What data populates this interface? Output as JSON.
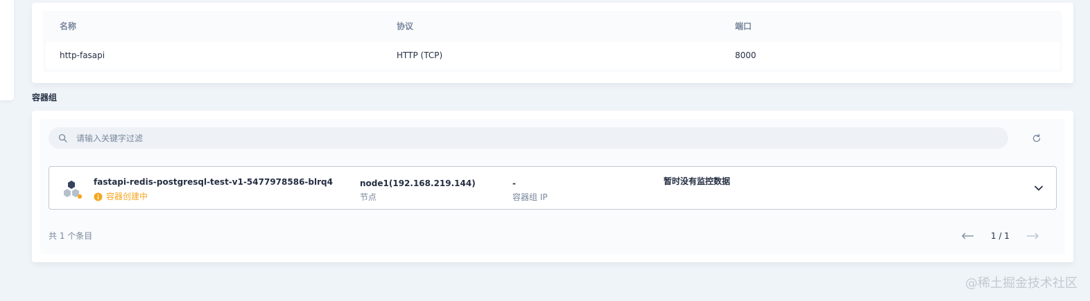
{
  "ports": {
    "headers": [
      "名称",
      "协议",
      "端口"
    ],
    "rows": [
      {
        "name": "http-fasapi",
        "protocol": "HTTP (TCP)",
        "port": "8000"
      }
    ]
  },
  "pods_section": {
    "title": "容器组",
    "search": {
      "placeholder": "请输入关键字过滤",
      "value": ""
    },
    "pods": [
      {
        "name": "fastapi-redis-postgresql-test-v1-5477978586-blrq4",
        "status": "容器创建中",
        "node_value": "node1(192.168.219.144)",
        "node_label": "节点",
        "ip_value": "-",
        "ip_label": "容器组 IP",
        "monitor_text": "暂时没有监控数据"
      }
    ],
    "total_text": "共 1 个条目",
    "page_indicator": "1 / 1"
  },
  "watermark": "@稀土掘金技术社区",
  "colors": {
    "background": "#eff4f9",
    "card": "#ffffff",
    "text_primary": "#242e42",
    "text_secondary": "#79879c",
    "status_warning": "#f5a623",
    "row_border": "#c1c9d1"
  },
  "icons": {
    "search": "search-icon",
    "refresh": "refresh-icon",
    "pod": "pod-icon",
    "status": "info-icon",
    "expand": "chevron-down-icon",
    "prev": "arrow-left-icon",
    "next": "arrow-right-icon"
  }
}
